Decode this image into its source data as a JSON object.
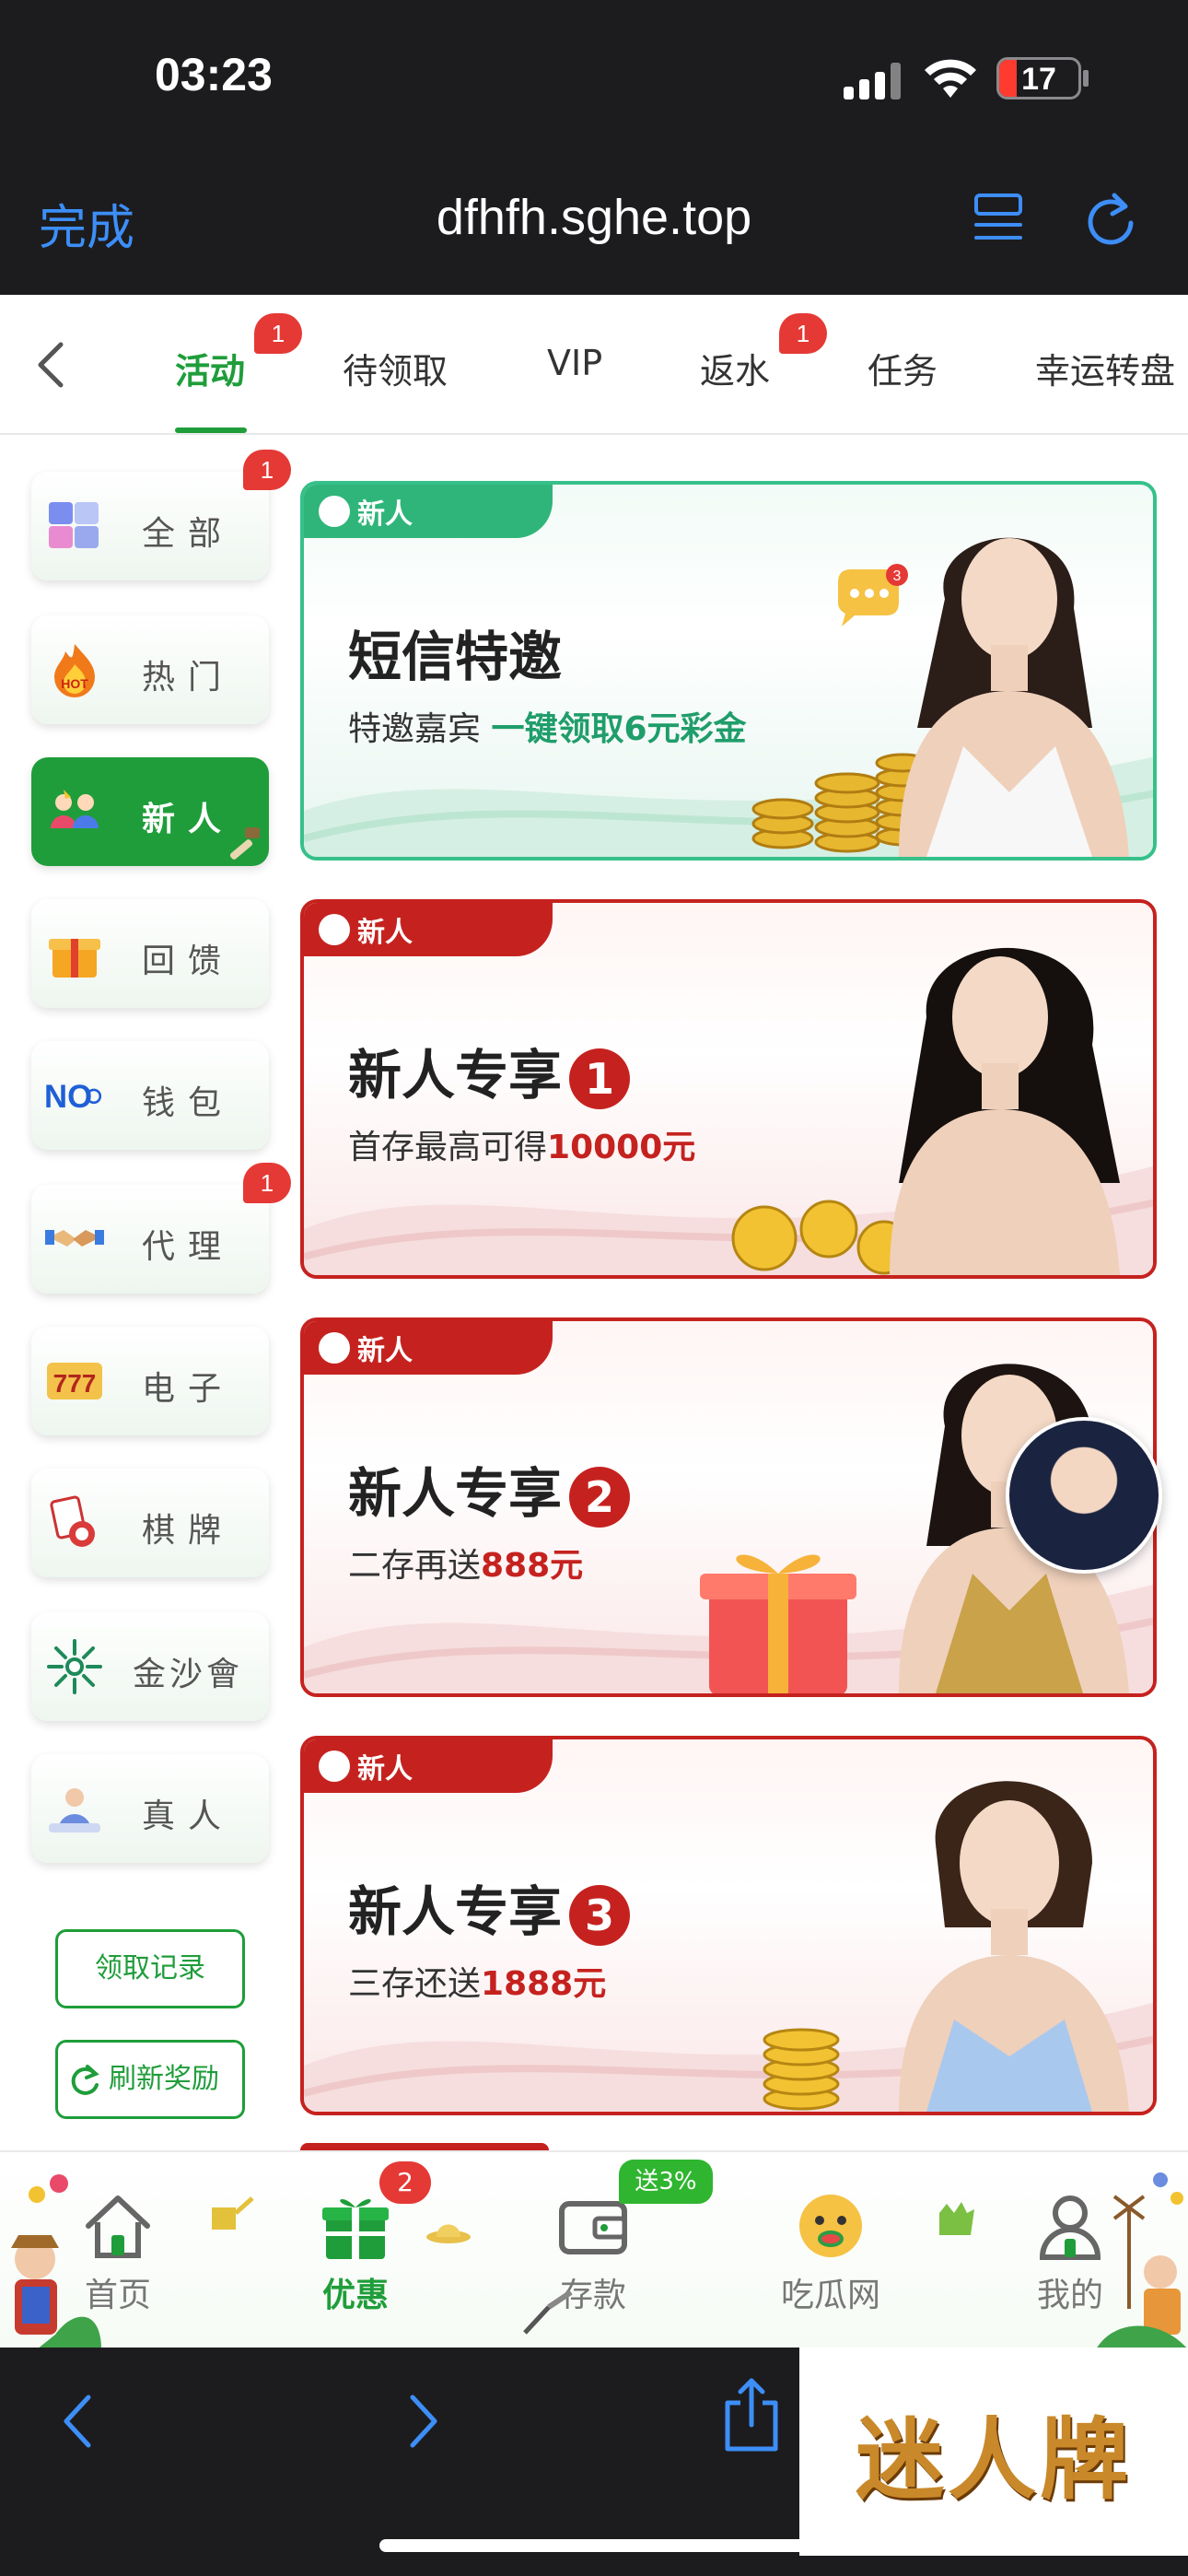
{
  "status_bar": {
    "time": "03:23",
    "battery_level": "17"
  },
  "browser": {
    "done_label": "完成",
    "url": "dfhfh.sghe.top"
  },
  "tabs": [
    {
      "label": "活动",
      "badge": "1",
      "active": true
    },
    {
      "label": "待领取"
    },
    {
      "label": "VIP"
    },
    {
      "label": "返水",
      "badge": "1"
    },
    {
      "label": "任务"
    },
    {
      "label": "幸运转盘"
    }
  ],
  "sidebar": {
    "items": [
      {
        "label": "全部",
        "badge": "1"
      },
      {
        "label": "热门"
      },
      {
        "label": "新人",
        "active": true
      },
      {
        "label": "回馈"
      },
      {
        "label": "钱包"
      },
      {
        "label": "代理",
        "badge": "1"
      },
      {
        "label": "电子"
      },
      {
        "label": "棋牌"
      },
      {
        "label": "金沙會"
      },
      {
        "label": "真人"
      }
    ],
    "hot_icon_text": "HOT",
    "wallet_icon_text": "NO",
    "records_button": "领取记录",
    "refresh_button": "刷新奖励"
  },
  "banners": [
    {
      "tag": "新人",
      "title": "短信特邀",
      "sub_prefix": "特邀嘉宾",
      "sub_highlight": "一键领取6元彩金",
      "style": "green",
      "chat_count": "3"
    },
    {
      "tag": "新人",
      "title": "新人专享",
      "number": "1",
      "sub_prefix": "首存最高可得",
      "sub_highlight": "10000元",
      "style": "red"
    },
    {
      "tag": "新人",
      "title": "新人专享",
      "number": "2",
      "sub_prefix": "二存再送",
      "sub_highlight": "888元",
      "style": "red"
    },
    {
      "tag": "新人",
      "title": "新人专享",
      "number": "3",
      "sub_prefix": "三存还送",
      "sub_highlight": "1888元",
      "style": "red"
    }
  ],
  "bottom_nav": [
    {
      "label": "首页",
      "icon": "home-icon"
    },
    {
      "label": "优惠",
      "icon": "gift-icon",
      "active": true,
      "badge": "2"
    },
    {
      "label": "存款",
      "icon": "wallet-icon",
      "promo": "送3%"
    },
    {
      "label": "吃瓜网",
      "icon": "emoji-icon"
    },
    {
      "label": "我的",
      "icon": "user-icon"
    }
  ],
  "watermark": "迷人牌",
  "colors": {
    "accent": "#1f9d3a",
    "badge": "#e53935",
    "banner_red": "#c5221f",
    "banner_green": "#2fb57a",
    "safari_blue": "#3d8ef7"
  }
}
